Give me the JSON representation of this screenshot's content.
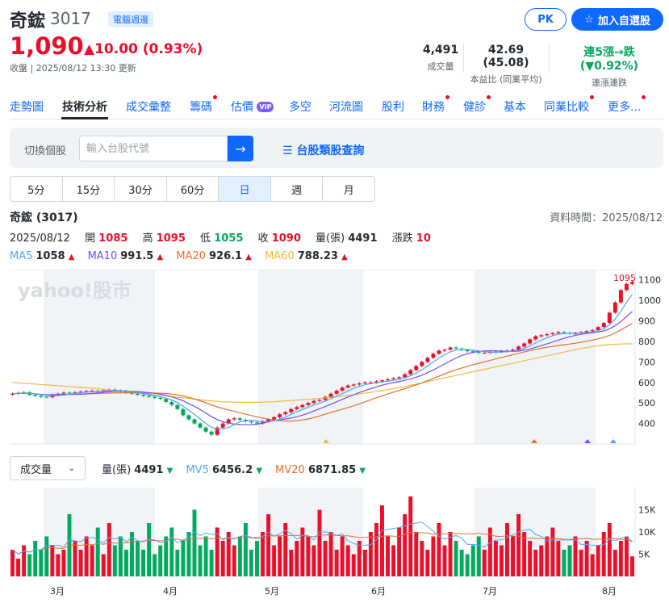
{
  "header": {
    "name": "奇鋐",
    "code": "3017",
    "badge": "電腦週邊",
    "price": "1,090",
    "change": "▲10.00 (0.93%)",
    "updated": "收盤 | 2025/08/12 13:30 更新",
    "pk_label": "PK",
    "add_label": "加入自選股"
  },
  "stats": [
    {
      "value": "4,491",
      "label": "成交量"
    },
    {
      "value": "42.69 (45.08)",
      "label": "本益比 (同業平均)"
    },
    {
      "value": "連5漲→跌 (▼0.92%)",
      "label": "連漲連跌"
    }
  ],
  "tabs": [
    "走勢圖",
    "技術分析",
    "成交彙整",
    "籌碼",
    "估價",
    "多空",
    "河流圖",
    "股利",
    "財務",
    "健診",
    "基本",
    "同業比較",
    "更多..."
  ],
  "vip_label": "VIP",
  "search": {
    "label": "切換個股",
    "placeholder": "輸入台股代號",
    "category_link": "台股類股查詢"
  },
  "periods": [
    "5分",
    "15分",
    "30分",
    "60分",
    "日",
    "週",
    "月"
  ],
  "chart_header": {
    "title": "奇鋐 (3017)",
    "data_time": "資料時間：2025/08/12",
    "date": "2025/08/12",
    "open_label": "開",
    "open": "1085",
    "high_label": "高",
    "high": "1095",
    "low_label": "低",
    "low": "1055",
    "close_label": "收",
    "close": "1090",
    "volume_label": "量(張)",
    "volume": "4491",
    "change_label": "漲跌",
    "change": "10"
  },
  "ma": [
    {
      "name": "MA5",
      "value": "1058",
      "color": "#4ea6f5"
    },
    {
      "name": "MA10",
      "value": "991.5",
      "color": "#6f4ef5"
    },
    {
      "name": "MA20",
      "value": "926.1",
      "color": "#e36f2f"
    },
    {
      "name": "MA60",
      "value": "788.23",
      "color": "#f0b83b"
    }
  ],
  "volume_header": {
    "select_label": "成交量",
    "vol_label": "量(張)",
    "vol": "4491",
    "mv5_label": "MV5",
    "mv5": "6456.2",
    "mv20_label": "MV20",
    "mv20": "6871.85"
  },
  "watermark": "yahoo!股市",
  "colors": {
    "up": "#eb0f29",
    "down": "#00ab5e",
    "accent": "#0f69ff"
  },
  "chart_data": {
    "type": "candlestick",
    "y_ticks": [
      "1100",
      "1000",
      "900",
      "800",
      "700",
      "600",
      "500",
      "400"
    ],
    "ylim": [
      300,
      1150
    ],
    "x_labels": [
      "3月",
      "4月",
      "5月",
      "6月",
      "7月",
      "8月"
    ],
    "annotations": {
      "high": "1095",
      "low": "340.5"
    },
    "close_series": [
      545,
      548,
      552,
      540,
      535,
      530,
      528,
      540,
      545,
      550,
      548,
      552,
      555,
      558,
      560,
      555,
      562,
      565,
      560,
      558,
      550,
      545,
      540,
      535,
      530,
      525,
      520,
      505,
      490,
      470,
      440,
      420,
      400,
      380,
      360,
      345,
      380,
      400,
      420,
      425,
      418,
      410,
      405,
      400,
      410,
      420,
      430,
      445,
      455,
      470,
      480,
      490,
      500,
      510,
      515,
      530,
      545,
      560,
      575,
      585,
      590,
      595,
      600,
      600,
      605,
      610,
      615,
      620,
      625,
      640,
      660,
      680,
      700,
      720,
      740,
      755,
      760,
      770,
      765,
      758,
      752,
      748,
      745,
      745,
      748,
      750,
      752,
      755,
      760,
      775,
      790,
      810,
      825,
      830,
      835,
      840,
      845,
      842,
      838,
      840,
      845,
      850,
      855,
      870,
      890,
      940,
      990,
      1050,
      1080,
      1090
    ],
    "ma60": [
      600,
      598,
      596,
      594,
      592,
      590,
      588,
      586,
      584,
      582,
      580,
      578,
      576,
      574,
      572,
      570,
      567,
      564,
      561,
      558,
      555,
      552,
      549,
      546,
      543,
      540,
      537,
      534,
      531,
      528,
      525,
      522,
      519,
      516,
      513,
      510,
      508,
      506,
      505,
      504,
      503,
      503,
      503,
      503,
      504,
      505,
      506,
      508,
      510,
      512,
      514,
      516,
      518,
      520,
      522,
      525,
      528,
      531,
      534,
      537,
      540,
      544,
      548,
      552,
      556,
      560,
      565,
      570,
      575,
      580,
      586,
      592,
      598,
      604,
      610,
      616,
      622,
      628,
      634,
      640,
      646,
      652,
      658,
      664,
      670,
      676,
      682,
      688,
      694,
      700,
      706,
      712,
      718,
      724,
      730,
      736,
      742,
      748,
      754,
      760,
      765,
      770,
      775,
      779,
      782,
      784,
      786,
      787,
      788,
      788.23
    ],
    "volume_series": [
      6,
      4,
      7,
      5,
      8,
      6,
      9,
      7,
      5,
      6,
      14,
      8,
      6,
      9,
      7,
      11,
      5,
      12,
      7,
      9,
      6,
      10,
      8,
      6,
      12,
      5,
      7,
      9,
      11,
      6,
      8,
      10,
      15,
      7,
      9,
      6,
      11,
      8,
      10,
      7,
      9,
      12,
      6,
      8,
      10,
      14,
      7,
      9,
      12,
      6,
      8,
      11,
      9,
      7,
      15,
      8,
      10,
      6,
      9,
      7,
      5,
      8,
      6,
      10,
      12,
      16,
      9,
      7,
      11,
      14,
      18,
      10,
      8,
      6,
      9,
      12,
      7,
      10,
      8,
      6,
      5,
      7,
      9,
      6,
      11,
      8,
      7,
      12,
      9,
      14,
      10,
      8,
      6,
      7,
      9,
      11,
      8,
      6,
      7,
      9,
      6,
      8,
      5,
      7,
      10,
      12,
      6,
      8,
      9,
      4.5
    ],
    "vol_y_ticks": [
      "15K",
      "10K",
      "5K"
    ]
  }
}
